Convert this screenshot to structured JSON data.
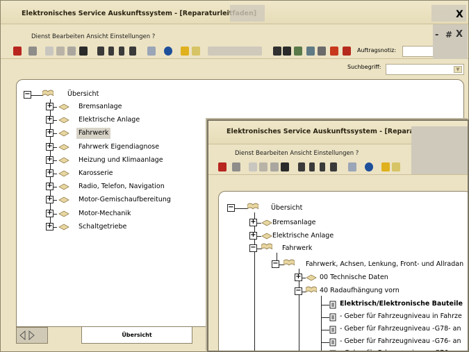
{
  "window": {
    "title": "Elektronisches Service Auskunftssystem - [Reparaturleitfaden]",
    "menu": "Dienst  Bearbeiten  Ansicht  Einstellungen  ?",
    "close_glyph": "X",
    "minimize_glyph": "-",
    "restore_glyph": "#",
    "auftrag_label": "Auftragsnotiz:",
    "such_label": "Suchbegriff:",
    "tab_label": "Übersicht",
    "tree": {
      "root": "Übersicht",
      "items": [
        "Bremsanlage",
        "Elektrische Anlage",
        "Fahrwerk",
        "Fahrwerk Eigendiagnose",
        "Heizung und Klimaanlage",
        "Karosserie",
        "Radio, Telefon, Navigation",
        "Motor-Gemischaufbereitung",
        "Motor-Mechanik",
        "Schaltgetriebe"
      ],
      "selected_index": 2
    }
  },
  "window2": {
    "title": "Elektronisches Service Auskunftssystem - [Reparaturleitfaden]",
    "menu": "Dienst  Bearbeiten  Ansicht  Einstellungen  ?",
    "tree": {
      "root": "Übersicht",
      "n1": "Bremsanlage",
      "n2": "Elektrische Anlage",
      "n3": "Fahrwerk",
      "n4": "Fahrwerk, Achsen, Lenkung, Front- und Allradan",
      "n5": "00  Technische Daten",
      "n6": "40  Radaufhängung vorn",
      "n7": "Elektrisch/Elektronische Bauteile",
      "n8": "-   Geber für Fahrzeugniveau in Fahrze",
      "n9": "-   Geber für Fahrzeugniveau -G78- an",
      "n10": "-   Geber für Fahrzeugniveau -G76- an",
      "n11": "-   Geber für Fahrzeugniveau -G76- an"
    }
  }
}
